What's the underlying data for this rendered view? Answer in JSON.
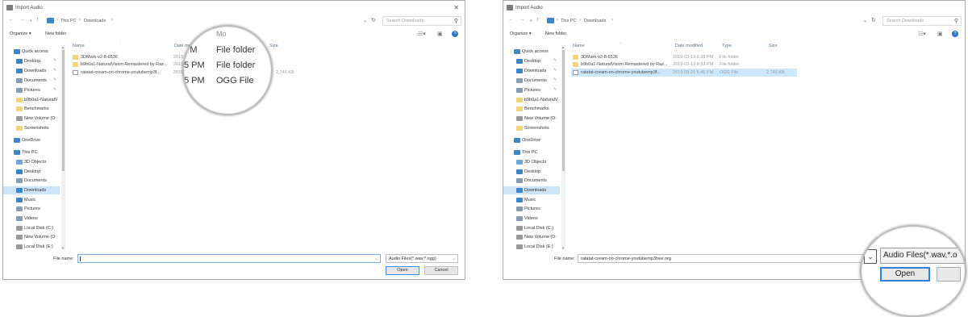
{
  "dialog_title": "Import Audio",
  "breadcrumb": [
    "This PC",
    "Downloads"
  ],
  "search_placeholder": "Search Downloads",
  "toolbar": {
    "organize": "Organize ▾",
    "new_folder": "New folder"
  },
  "nav_items": [
    {
      "label": "Quick access",
      "icon": "star-icon"
    },
    {
      "label": "Desktop",
      "icon": "desktop-icon"
    },
    {
      "label": "Downloads",
      "icon": "download-icon"
    },
    {
      "label": "Documents",
      "icon": "documents-icon"
    },
    {
      "label": "Pictures",
      "icon": "pictures-icon"
    },
    {
      "label": "b9b0a1-NaturalV",
      "icon": "folder-icon"
    },
    {
      "label": "Benchmarks",
      "icon": "folder-icon"
    },
    {
      "label": "New Volume (D:",
      "icon": "drive-icon"
    },
    {
      "label": "Screenshots",
      "icon": "folder-icon"
    },
    {
      "label": "OneDrive",
      "icon": "cloud-icon"
    },
    {
      "label": "This PC",
      "icon": "pc-icon"
    },
    {
      "label": "3D Objects",
      "icon": "cube-icon"
    },
    {
      "label": "Desktop",
      "icon": "desktop-icon"
    },
    {
      "label": "Documents",
      "icon": "documents-icon"
    },
    {
      "label": "Downloads",
      "icon": "download-icon"
    },
    {
      "label": "Music",
      "icon": "music-icon"
    },
    {
      "label": "Pictures",
      "icon": "pictures-icon"
    },
    {
      "label": "Videos",
      "icon": "videos-icon"
    },
    {
      "label": "Local Disk (C:)",
      "icon": "drive-icon"
    },
    {
      "label": "New Volume (D:",
      "icon": "drive-icon"
    },
    {
      "label": "Local Disk (E:)",
      "icon": "drive-icon"
    }
  ],
  "columns": {
    "name": "Name",
    "date": "Date modified",
    "date_cut": "Date mo",
    "type": "Type",
    "size": "Size"
  },
  "files": [
    {
      "name": "3DMark-v2-8-6536",
      "date": "2019-03-13 6:38 PM",
      "type": "File folder",
      "size": "",
      "kind": "folder"
    },
    {
      "name": "b9b0a1-NaturalVision Remastered by Raz...",
      "date": "2019-03-13 8:33 PM",
      "type": "File folder",
      "size": "",
      "kind": "folder"
    },
    {
      "name": "ratatat-cream-on-chrome-youtubemp3f...",
      "date": "2019-03-21 6:45 PM",
      "type": "OGG File",
      "size": "2,746 KB",
      "kind": "ogg"
    }
  ],
  "dlg1_dates_cut": [
    "2019-",
    "2019-",
    "2019-"
  ],
  "bottom": {
    "file_name_label": "File name:",
    "file_name_value": "ratatat-cream-on-chrome-youtubemp3free.org",
    "filter": "Audio Files(*.wav;*.ogg)",
    "open": "Open",
    "cancel": "Cancel"
  },
  "magnifier1": {
    "top_fragment": "Mo",
    "rows": [
      {
        "time": "PM",
        "type": "File folder"
      },
      {
        "time": "5 PM",
        "type": "File folder"
      },
      {
        "time": "5 PM",
        "type": "OGG File"
      }
    ]
  },
  "magnifier2": {
    "filter_text": "Audio Files(*.wav,*.o",
    "open": "Open"
  }
}
